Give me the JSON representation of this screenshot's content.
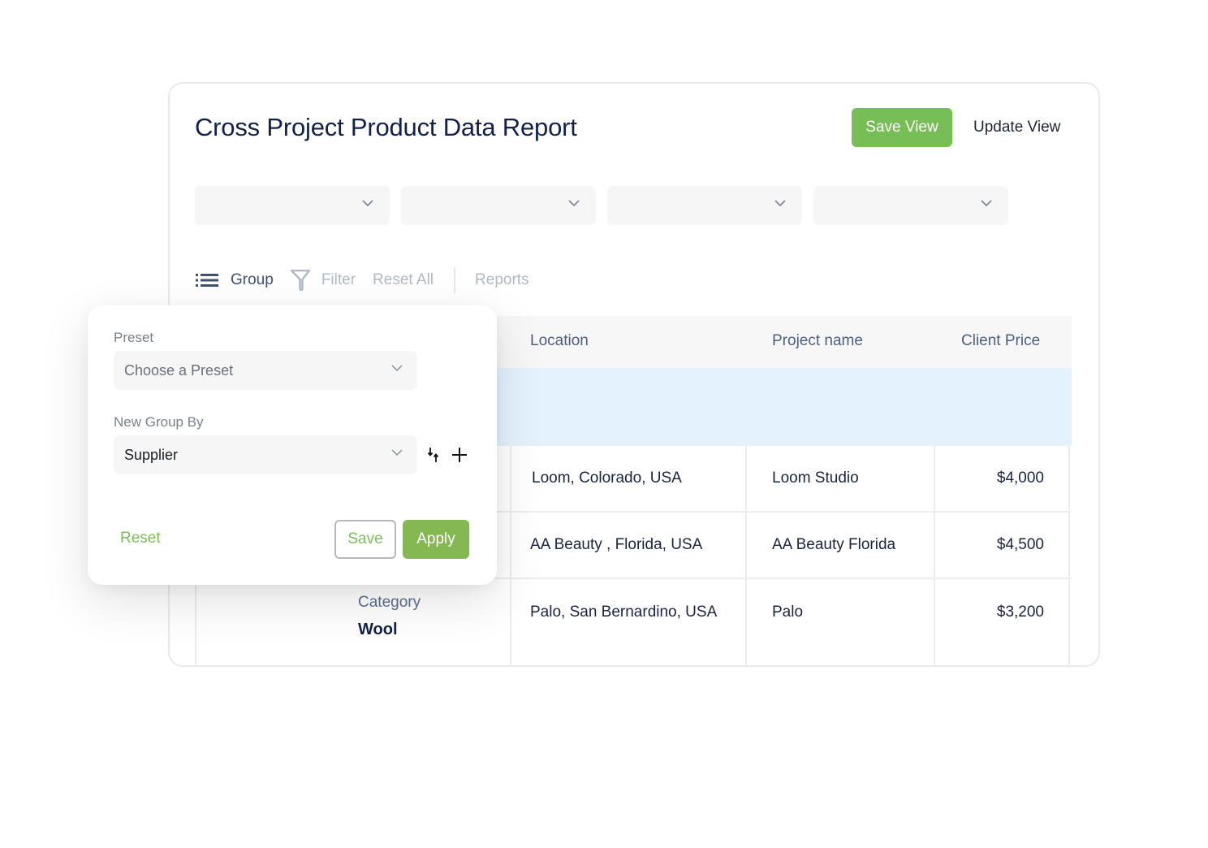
{
  "header": {
    "title": "Cross Project Product Data Report",
    "save_view_label": "Save View",
    "update_view_label": "Update View"
  },
  "filters": [
    {
      "value": "",
      "icon": "chevron-down-icon"
    },
    {
      "value": "",
      "icon": "chevron-down-icon"
    },
    {
      "value": "",
      "icon": "chevron-down-icon"
    },
    {
      "value": "",
      "icon": "chevron-down-icon"
    }
  ],
  "toolbar": {
    "group_label": "Group",
    "filter_label": "Filter",
    "reset_all_label": "Reset All",
    "reports_label": "Reports"
  },
  "table": {
    "columns": [
      "Location",
      "Project name",
      "Client Price"
    ],
    "rows": [
      {
        "location": "Loom, Colorado, USA",
        "project": "Loom Studio",
        "price": "$4,000"
      },
      {
        "location": "AA Beauty , Florida, USA",
        "project": "AA Beauty Florida",
        "price": "$4,500"
      },
      {
        "location": "Palo, San Bernardino, USA",
        "project": "Palo",
        "price": "$3,200"
      }
    ],
    "group_cell": {
      "label": "Category",
      "value": "Wool"
    }
  },
  "group_popup": {
    "preset_label": "Preset",
    "preset_placeholder": "Choose a Preset",
    "group_by_label": "New Group By",
    "group_by_value": "Supplier",
    "reset_label": "Reset",
    "save_label": "Save",
    "apply_label": "Apply"
  },
  "colors": {
    "accent_green": "#78be56",
    "apply_green": "#85b752",
    "title_navy": "#13214a",
    "group_row_blue": "#e4f2fd"
  }
}
